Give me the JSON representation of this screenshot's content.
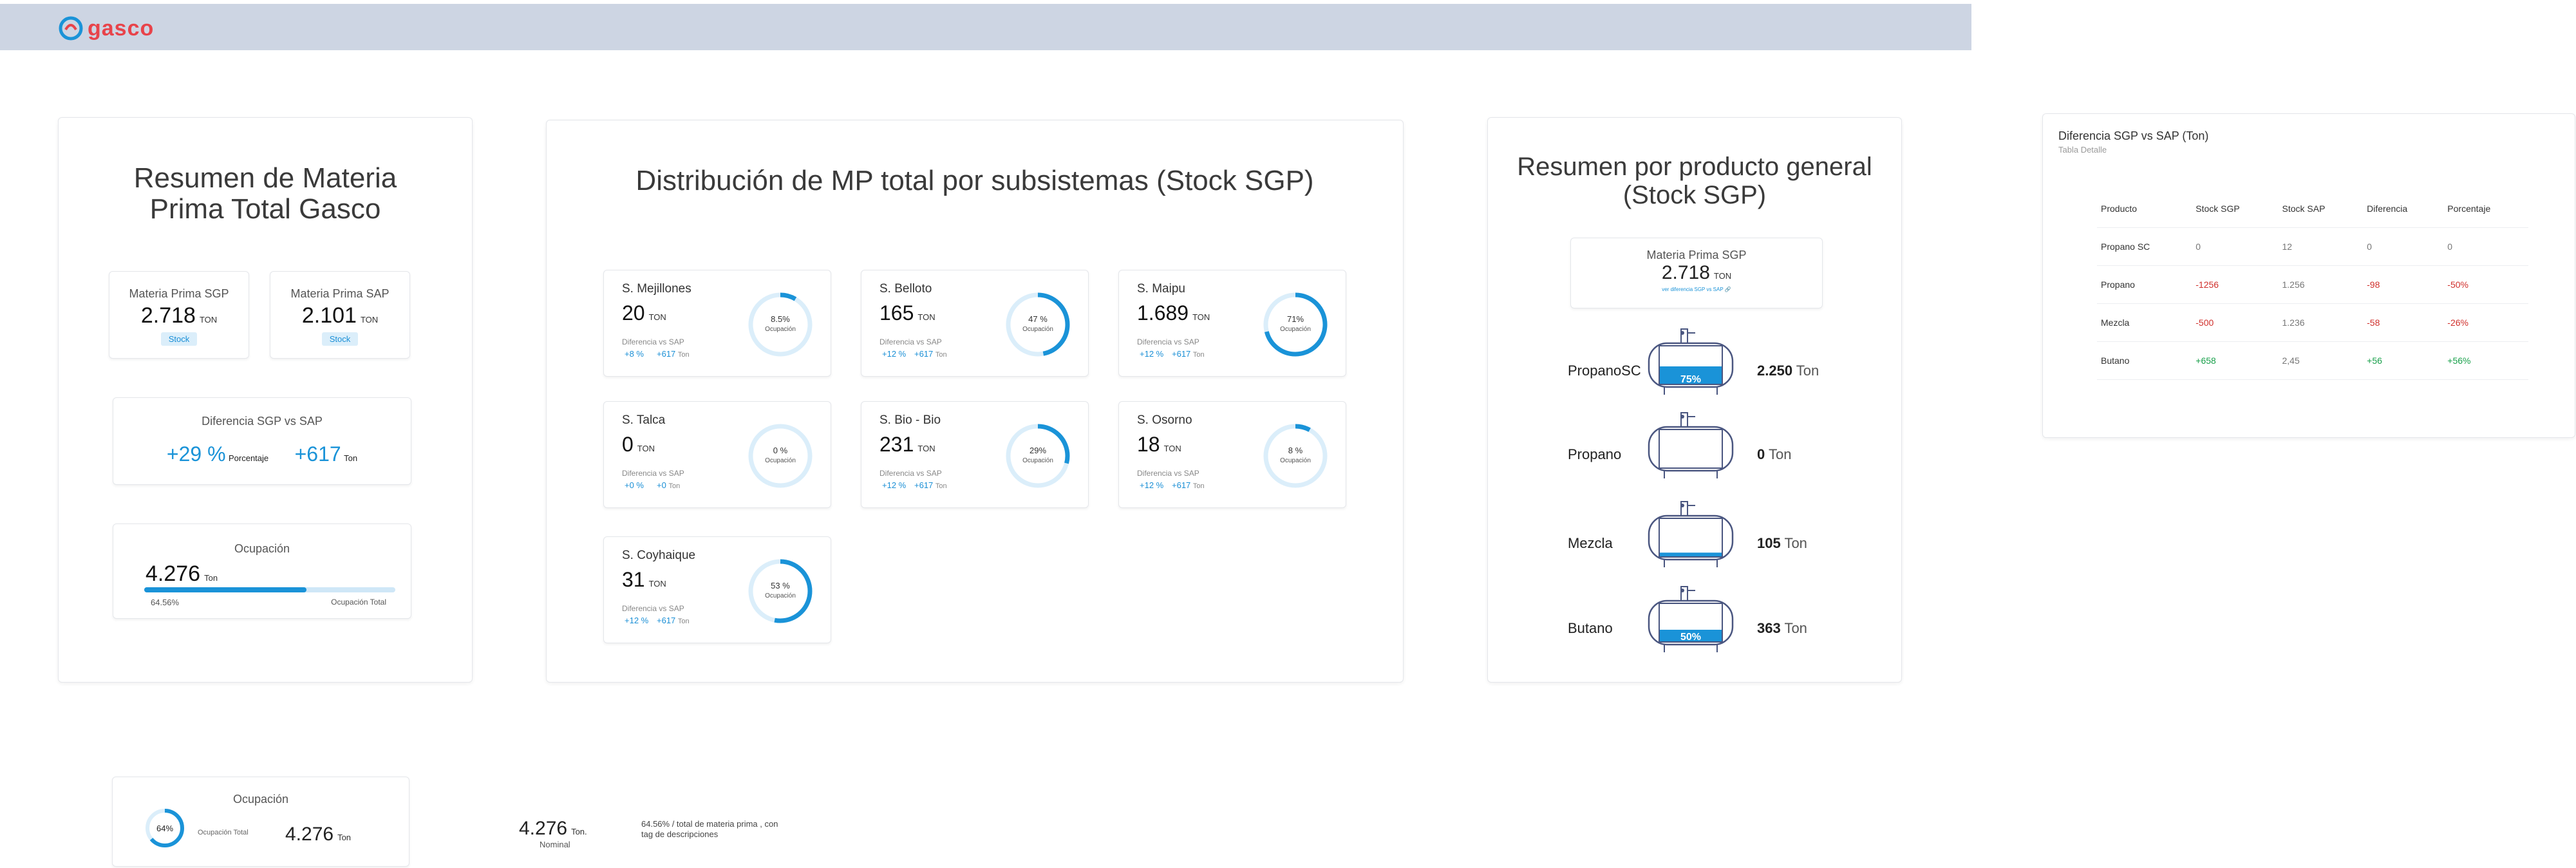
{
  "header": {
    "logo": "gasco"
  },
  "resumen": {
    "title": "Resumen de Materia Prima Total Gasco",
    "sgp": {
      "label": "Materia Prima SGP",
      "value": "2.718",
      "unit": "TON",
      "chip": "Stock"
    },
    "sap": {
      "label": "Materia Prima SAP",
      "value": "2.101",
      "unit": "TON",
      "chip": "Stock"
    },
    "diff": {
      "label": "Diferencia SGP vs SAP",
      "pct": "+29 %",
      "pct_label": "Porcentaje",
      "ton": "+617",
      "ton_label": "Ton"
    },
    "ocupacion": {
      "label": "Ocupación",
      "value": "4.276",
      "unit": "Ton",
      "pct": "64.56%",
      "total_label": "Ocupación Total",
      "fill": 0.6456
    }
  },
  "distribucion": {
    "title": "Distribución de MP total por subsistemas (Stock SGP)",
    "diff_label": "Diferencia vs SAP",
    "ocup_label": "Ocupación",
    "items": [
      {
        "name": "S. Mejillones",
        "value": "20",
        "unit": "TON",
        "pct_text": "8.5%",
        "pct": 8.5,
        "d_pct": "+8 %",
        "d_ton": "+617",
        "ton": "Ton"
      },
      {
        "name": "S. Belloto",
        "value": "165",
        "unit": "TON",
        "pct_text": "47 %",
        "pct": 47,
        "d_pct": "+12 %",
        "d_ton": "+617",
        "ton": "Ton"
      },
      {
        "name": "S. Maipu",
        "value": "1.689",
        "unit": "TON",
        "pct_text": "71%",
        "pct": 71,
        "d_pct": "+12 %",
        "d_ton": "+617",
        "ton": "Ton"
      },
      {
        "name": "S. Talca",
        "value": "0",
        "unit": "TON",
        "pct_text": "0 %",
        "pct": 0,
        "d_pct": "+0 %",
        "d_ton": "+0",
        "ton": "Ton"
      },
      {
        "name": "S. Bio - Bio",
        "value": "231",
        "unit": "TON",
        "pct_text": "29%",
        "pct": 29,
        "d_pct": "+12 %",
        "d_ton": "+617",
        "ton": "Ton"
      },
      {
        "name": "S. Osorno",
        "value": "18",
        "unit": "TON",
        "pct_text": "8 %",
        "pct": 8,
        "d_pct": "+12 %",
        "d_ton": "+617",
        "ton": "Ton"
      },
      {
        "name": "S. Coyhaique",
        "value": "31",
        "unit": "TON",
        "pct_text": "53 %",
        "pct": 53,
        "d_pct": "+12 %",
        "d_ton": "+617",
        "ton": "Ton"
      }
    ]
  },
  "producto": {
    "title": "Resumen por producto general (Stock SGP)",
    "mp": {
      "label": "Materia Prima SGP",
      "value": "2.718",
      "unit": "TON",
      "link": "ver diferencia SGP vs SAP"
    },
    "tanks": [
      {
        "name": "PropanoSC",
        "pct_text": "75%",
        "fill": 0.75,
        "value": "2.250",
        "unit": "Ton"
      },
      {
        "name": "Propano",
        "pct_text": "0 %",
        "fill": 0.0,
        "value": "0",
        "unit": "Ton"
      },
      {
        "name": "Mezcla",
        "pct_text": "16%",
        "fill": 0.16,
        "value": "105",
        "unit": "Ton"
      },
      {
        "name": "Butano",
        "pct_text": "50%",
        "fill": 0.5,
        "value": "363",
        "unit": "Ton"
      }
    ]
  },
  "tabla": {
    "title": "Diferencia SGP vs SAP (Ton)",
    "subtitle": "Tabla Detalle",
    "headers": [
      "Producto",
      "Stock SGP",
      "Stock SAP",
      "Diferencia",
      "Porcentaje"
    ],
    "rows": [
      {
        "cells": [
          "Propano SC",
          "0",
          "12",
          "0",
          "0"
        ],
        "tone": "muted"
      },
      {
        "cells": [
          "Propano",
          "-1256",
          "1.256",
          "-98",
          "-50%"
        ],
        "tone": "neg"
      },
      {
        "cells": [
          "Mezcla",
          "-500",
          "1.236",
          "-58",
          "-26%"
        ],
        "tone": "neg"
      },
      {
        "cells": [
          "Butano",
          "+658",
          "2,45",
          "+56",
          "+56%"
        ],
        "tone": "pos"
      }
    ]
  },
  "ocupacion_mini": {
    "label": "Ocupación",
    "pct_text": "64%",
    "pct": 64,
    "total_label": "Ocupación Total",
    "value": "4.276",
    "unit": "Ton"
  },
  "nominal": {
    "value": "4.276",
    "unit": "Ton",
    "suffix": ".",
    "sub": "Nominal",
    "desc": "64.56% / total de materia prima , con tag de descripciones"
  },
  "colors": {
    "accent": "#1a93d8",
    "topbar": "#cdd5e3",
    "brand": "#e8434a",
    "positive": "#19a04b",
    "negative": "#d0302c"
  }
}
